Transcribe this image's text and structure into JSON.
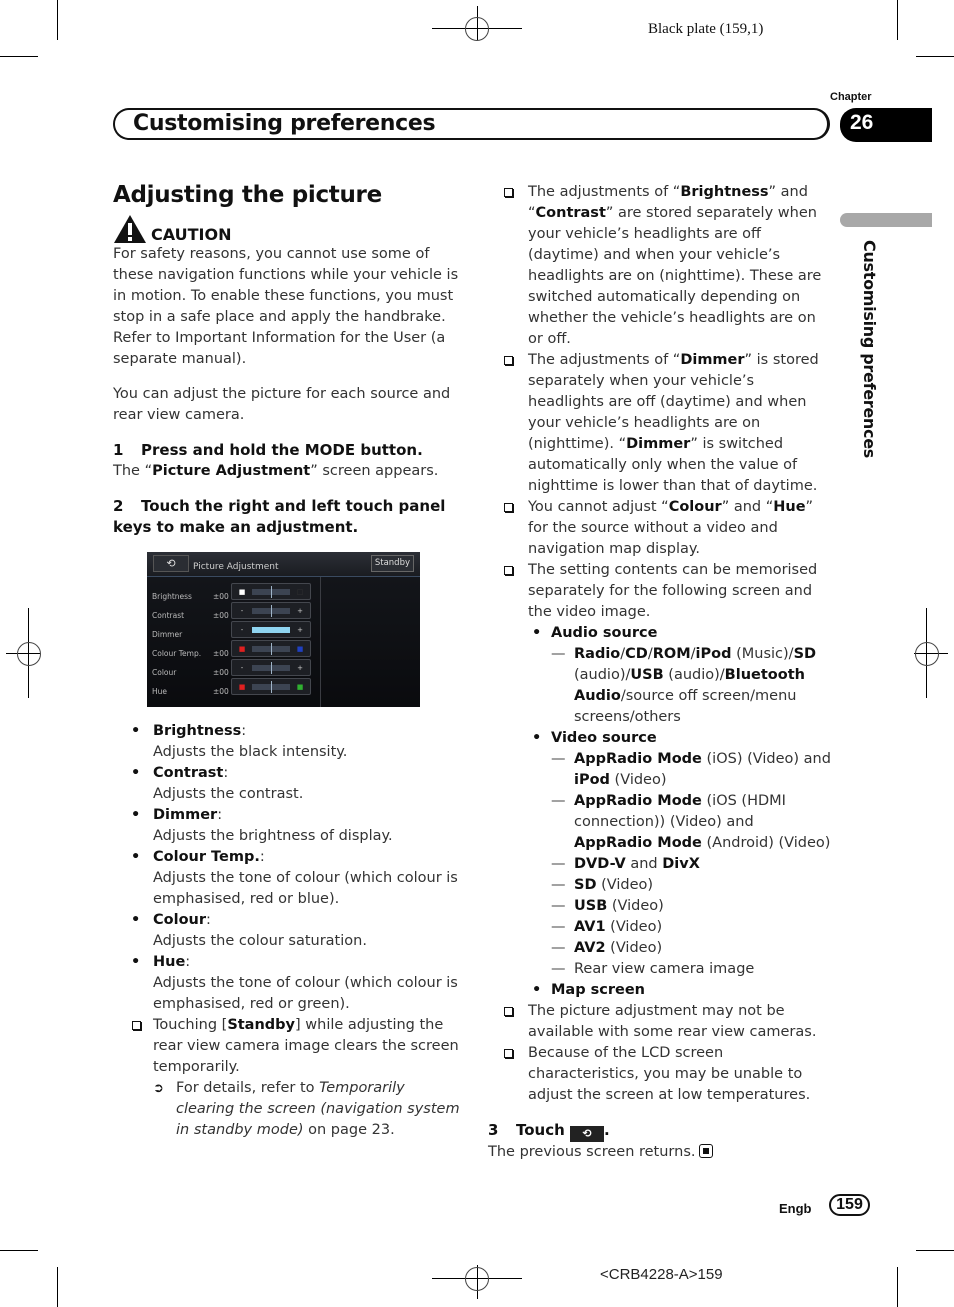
{
  "print_marks": {
    "plate": "Black plate (159,1)",
    "doc_code": "<CRB4228-A>159"
  },
  "header": {
    "chapter_label": "Chapter",
    "chapter_number": "26",
    "title": "Customising preferences",
    "side_label": "Customising preferences"
  },
  "section": {
    "title": "Adjusting the picture",
    "caution_icon": "warning-triangle-icon",
    "caution_label": "CAUTION",
    "caution_text": "For safety reasons, you cannot use some of these navigation functions while your vehicle is in motion. To enable these functions, you must stop in a safe place and apply the handbrake. Refer to Important Information for the User (a separate manual).",
    "intro": "You can adjust the picture for each source and rear view camera."
  },
  "steps": {
    "step1": {
      "num": "1",
      "text": "Press and hold the MODE button.",
      "result_pre": "The “",
      "result_bold": "Picture Adjustment",
      "result_post": "” screen appears."
    },
    "step2": {
      "num": "2",
      "text": "Touch the right and left touch panel keys to make an adjustment."
    },
    "step3": {
      "num": "3",
      "text": "Touch",
      "icon": "back-arrow-icon",
      "icon_glyph": "⟲",
      "after": ".",
      "result": "The previous screen returns.",
      "end_icon": "end-of-section-icon"
    }
  },
  "screen": {
    "back_glyph": "⟲",
    "title": "Picture Adjustment",
    "standby": "Standby",
    "rows": [
      {
        "label": "Brightness",
        "value": "±00",
        "left": "■",
        "right": "□",
        "left_color": "#ffffff",
        "right_color": "#333333",
        "position": 0.5
      },
      {
        "label": "Contrast",
        "value": "±00",
        "left": "-",
        "right": "+",
        "left_color": "",
        "right_color": "",
        "position": 0.5
      },
      {
        "label": "Dimmer",
        "value": "",
        "left": "-",
        "right": "+",
        "left_color": "",
        "right_color": "",
        "position": 1.0
      },
      {
        "label": "Colour Temp.",
        "value": "±00",
        "left": "■",
        "right": "■",
        "left_color": "#e02020",
        "right_color": "#2040c0",
        "position": 0.5
      },
      {
        "label": "Colour",
        "value": "±00",
        "left": "-",
        "right": "+",
        "left_color": "",
        "right_color": "",
        "position": 0.5
      },
      {
        "label": "Hue",
        "value": "±00",
        "left": "■",
        "right": "■",
        "left_color": "#e02020",
        "right_color": "#30b030",
        "position": 0.5
      }
    ]
  },
  "settings_list": [
    {
      "name": "Brightness",
      "desc": "Adjusts the black intensity."
    },
    {
      "name": "Contrast",
      "desc": "Adjusts the contrast."
    },
    {
      "name": "Dimmer",
      "desc": "Adjusts the brightness of display."
    },
    {
      "name": "Colour Temp.",
      "desc": "Adjusts the tone of colour (which colour is emphasised, red or blue)."
    },
    {
      "name": "Colour",
      "desc": "Adjusts the colour saturation."
    },
    {
      "name": "Hue",
      "desc": "Adjusts the tone of colour (which colour is emphasised, red or green)."
    }
  ],
  "standby_note": {
    "pre": "Touching [",
    "bold": "Standby",
    "post": "] while adjusting the rear view camera image clears the screen temporarily.",
    "ref_pre": "For details, refer to ",
    "ref_italic": "Temporarily clearing the screen (navigation system in standby mode)",
    "ref_post": " on page 23."
  },
  "right_notes": {
    "note1": {
      "a": "The adjustments of “",
      "b1": "Brightness",
      "c": "” and “",
      "b2": "Contrast",
      "d": "” are stored separately when your vehicle’s headlights are off (daytime) and when your vehicle’s headlights are on (nighttime). These are switched automatically depending on whether the vehicle’s headlights are on or off."
    },
    "note2": {
      "a": "The adjustments of “",
      "b1": "Dimmer",
      "c": "” is stored separately when your vehicle’s headlights are off (daytime) and when your vehicle’s headlights are on (nighttime). “",
      "b2": "Dimmer",
      "d": "” is switched automatically only when the value of nighttime is lower than that of daytime."
    },
    "note3": {
      "a": "You cannot adjust “",
      "b1": "Colour",
      "c": "” and “",
      "b2": "Hue",
      "d": "” for the source without a video and navigation map display."
    },
    "note4": "The setting contents can be memorised separately for the following screen and the video image.",
    "audio_source": {
      "heading": "Audio source",
      "item": [
        {
          "t": "Radio",
          "b": true
        },
        {
          "t": "/",
          "b": false
        },
        {
          "t": "CD",
          "b": true
        },
        {
          "t": "/",
          "b": false
        },
        {
          "t": "ROM",
          "b": true
        },
        {
          "t": "/",
          "b": false
        },
        {
          "t": "iPod",
          "b": true
        },
        {
          "t": " (Music)/",
          "b": false
        },
        {
          "t": "SD",
          "b": true
        },
        {
          "t": " (audio)/",
          "b": false
        },
        {
          "t": "USB",
          "b": true
        },
        {
          "t": " (audio)/",
          "b": false
        },
        {
          "t": "Bluetooth Audio",
          "b": true
        },
        {
          "t": "/source off screen/menu screens/others",
          "b": false
        }
      ]
    },
    "video_source": {
      "heading": "Video source",
      "items": [
        [
          {
            "t": "AppRadio Mode",
            "b": true
          },
          {
            "t": " (iOS) (Video) and ",
            "b": false
          },
          {
            "t": "iPod",
            "b": true
          },
          {
            "t": " (Video)",
            "b": false
          }
        ],
        [
          {
            "t": "AppRadio Mode",
            "b": true
          },
          {
            "t": " (iOS (HDMI connection)) (Video) and ",
            "b": false
          },
          {
            "t": "AppRadio Mode",
            "b": true
          },
          {
            "t": " (Android) (Video)",
            "b": false
          }
        ],
        [
          {
            "t": "DVD-V",
            "b": true
          },
          {
            "t": " and ",
            "b": false
          },
          {
            "t": "DivX",
            "b": true
          }
        ],
        [
          {
            "t": "SD",
            "b": true
          },
          {
            "t": " (Video)",
            "b": false
          }
        ],
        [
          {
            "t": "USB",
            "b": true
          },
          {
            "t": " (Video)",
            "b": false
          }
        ],
        [
          {
            "t": "AV1",
            "b": true
          },
          {
            "t": " (Video)",
            "b": false
          }
        ],
        [
          {
            "t": "AV2",
            "b": true
          },
          {
            "t": " (Video)",
            "b": false
          }
        ],
        [
          {
            "t": "Rear view camera image",
            "b": false
          }
        ]
      ]
    },
    "map_screen": "Map screen",
    "note5": "The picture adjustment may not be available with some rear view cameras.",
    "note6": "Because of the LCD screen characteristics, you may be unable to adjust the screen at low temperatures."
  },
  "footer": {
    "lang": "Engb",
    "page": "159"
  }
}
